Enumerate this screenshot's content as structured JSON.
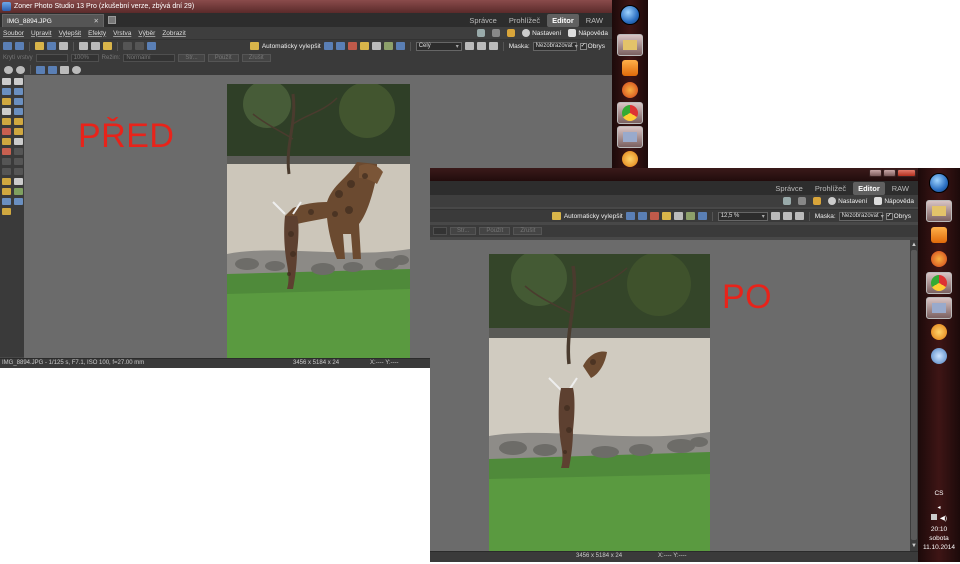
{
  "window_top": {
    "title": "Zoner Photo Studio 13 Pro (zkušební verze, zbývá dní 29)",
    "doc_tab": "IMG_8894.JPG",
    "mode_tabs": [
      "Správce",
      "Prohlížeč",
      "Editor",
      "RAW"
    ],
    "active_mode": "Editor",
    "menu": [
      "Soubor",
      "Upravit",
      "Vylepšit",
      "Efekty",
      "Vrstva",
      "Výběr",
      "Zobrazit"
    ],
    "nastaveni": "Nastavení",
    "napoveda": "Nápověda",
    "auto_enhance": "Automaticky vylepšit",
    "zoom_combo": "Celý",
    "mask_label": "Maska:",
    "mask_value": "Nezobrazovat",
    "outline_label": "Obrys",
    "opt_layer": "Krytí vrstvy",
    "opt_percent": "100%",
    "opt_mode_label": "Režim:",
    "opt_mode_value": "Normální",
    "opt_btn1": "Str...",
    "opt_btn2": "Použít",
    "opt_btn3": "Zrušit",
    "canvas_label": "PŘED",
    "status_file": "IMG_8894.JPG - 1/125 s, F7.1, ISO 100, f=27.00 mm",
    "status_dims": "3456 x 5184 x 24",
    "status_xy": "X:---- Y:----"
  },
  "window_bottom": {
    "mode_tabs": [
      "Správce",
      "Prohlížeč",
      "Editor",
      "RAW"
    ],
    "active_mode": "Editor",
    "nastaveni": "Nastavení",
    "napoveda": "Nápověda",
    "auto_enhance": "Automaticky vylepšit",
    "zoom_combo": "12,5 %",
    "mask_label": "Maska:",
    "mask_value": "Nezobrazovat",
    "outline_label": "Obrys",
    "opt_btn1": "Str...",
    "opt_btn2": "Použít",
    "opt_btn3": "Zrušit",
    "canvas_label": "PO",
    "status_dims": "3456 x 5184 x 24",
    "status_xy": "X:---- Y:----"
  },
  "system_tray": {
    "language": "CS",
    "time": "20:10",
    "day": "sobota",
    "date": "11.10.2014"
  },
  "colors": {
    "label_red": "#e8231a",
    "app_bg": "#484848",
    "canvas_bg": "#6b6b6b",
    "taskbar": "#3e1515"
  },
  "icons": {
    "taskbar": [
      "windows-orb-icon",
      "file-explorer-icon",
      "media-player-icon",
      "firefox-icon",
      "chrome-icon",
      "photo-viewer-icon",
      "zoner-icon",
      "settings-icon"
    ]
  }
}
